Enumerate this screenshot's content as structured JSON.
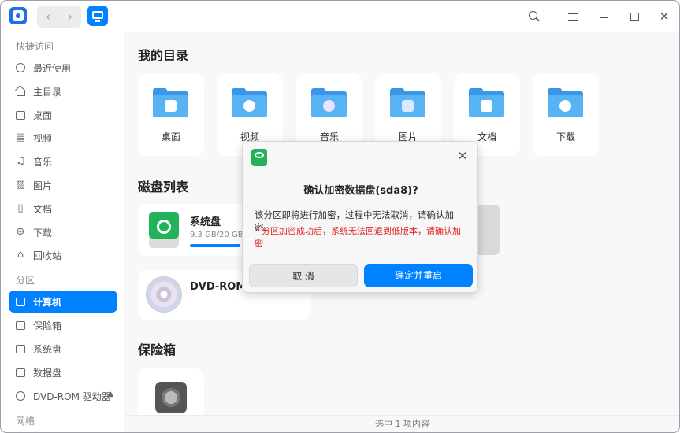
{
  "titlebar": {
    "back": "‹",
    "forward": "›",
    "close": "✕",
    "icons": [
      "app-logo-icon",
      "search-icon",
      "menu-icon",
      "minimize-icon",
      "maximize-icon",
      "close-icon"
    ]
  },
  "sidebar": {
    "sections": {
      "quick": "快捷访问",
      "partition": "分区",
      "network": "网络"
    },
    "quick_items": [
      {
        "label": "最近使用",
        "icon": "clock-icon"
      },
      {
        "label": "主目录",
        "icon": "home-icon"
      },
      {
        "label": "桌面",
        "icon": "desktop-icon"
      },
      {
        "label": "视频",
        "icon": "video-icon"
      },
      {
        "label": "音乐",
        "icon": "music-icon"
      },
      {
        "label": "图片",
        "icon": "picture-icon"
      },
      {
        "label": "文档",
        "icon": "document-icon"
      },
      {
        "label": "下载",
        "icon": "download-icon"
      },
      {
        "label": "回收站",
        "icon": "trash-icon"
      }
    ],
    "partition_items": [
      {
        "label": "计算机",
        "icon": "computer-icon",
        "active": true
      },
      {
        "label": "保险箱",
        "icon": "vault-icon"
      },
      {
        "label": "系统盘",
        "icon": "disk-icon"
      },
      {
        "label": "数据盘",
        "icon": "disk-icon"
      },
      {
        "label": "DVD-ROM 驱动器",
        "icon": "dvd-icon",
        "eject": "▲"
      }
    ]
  },
  "main": {
    "my_dirs_title": "我的目录",
    "folders": [
      {
        "label": "桌面",
        "icon": "desktop-folder-icon"
      },
      {
        "label": "视频",
        "icon": "video-folder-icon"
      },
      {
        "label": "音乐",
        "icon": "music-folder-icon"
      },
      {
        "label": "图片",
        "icon": "picture-folder-icon"
      },
      {
        "label": "文档",
        "icon": "document-folder-icon"
      },
      {
        "label": "下载",
        "icon": "download-folder-icon"
      }
    ],
    "disks_title": "磁盘列表",
    "system_disk": {
      "name": "系统盘",
      "size": "9.3 GB/20 GB",
      "usage": 0.465
    },
    "dvd": {
      "name": "DVD-ROM 驱"
    },
    "vault_title": "保险箱"
  },
  "status": {
    "text": "选中 1 项内容"
  },
  "dialog": {
    "title": "确认加密数据盘(sda8)?",
    "message": "该分区即将进行加密，过程中无法取消，请确认加密。",
    "warning": "* 分区加密成功后，系统无法回退到低版本，请确认加密",
    "close": "✕",
    "cancel": "取 消",
    "confirm": "确定并重启"
  },
  "colors": {
    "accent": "#0081ff",
    "warning": "#e02020"
  }
}
